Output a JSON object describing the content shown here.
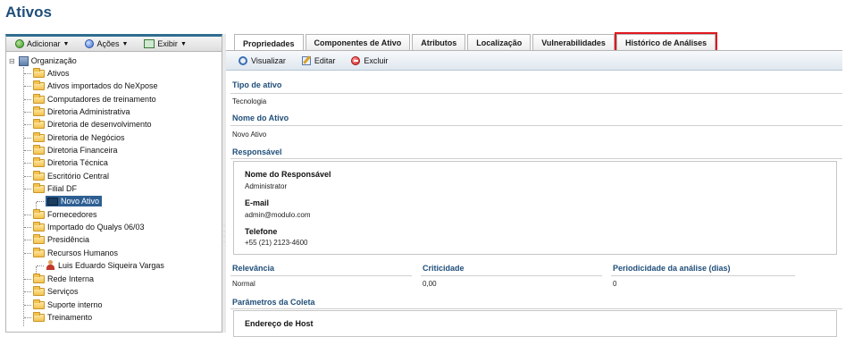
{
  "page": {
    "title": "Ativos"
  },
  "left_toolbar": {
    "add_label": "Adicionar",
    "actions_label": "Ações",
    "view_label": "Exibir"
  },
  "tree": {
    "root": "Organização",
    "items": [
      "Ativos",
      "Ativos importados do NeXpose",
      "Computadores de treinamento",
      "Diretoria Administrativa",
      "Diretoria de desenvolvimento",
      "Diretoria de Negócios",
      "Diretoria Financeira",
      "Diretoria Técnica",
      "Escritório Central",
      "Filial DF",
      "Novo Ativo",
      "Fornecedores",
      "Importado do Qualys 06/03",
      "Presidência",
      "Recursos Humanos",
      "Luis Eduardo Siqueira Vargas",
      "Rede Interna",
      "Serviços",
      "Suporte interno",
      "Treinamento"
    ]
  },
  "tabs": [
    "Propriedades",
    "Componentes de Ativo",
    "Atributos",
    "Localização",
    "Vulnerabilidades",
    "Histórico de Análises"
  ],
  "actions": {
    "view_label": "Visualizar",
    "edit_label": "Editar",
    "delete_label": "Excluir"
  },
  "properties": {
    "asset_type_label": "Tipo de ativo",
    "asset_type_value": "Tecnologia",
    "asset_name_label": "Nome do Ativo",
    "asset_name_value": "Novo Ativo",
    "responsible_label": "Responsável",
    "responsible": {
      "name_label": "Nome do Responsável",
      "name_value": "Administrator",
      "email_label": "E-mail",
      "email_value": "admin@modulo.com",
      "phone_label": "Telefone",
      "phone_value": "+55 (21) 2123-4600"
    },
    "relevance_label": "Relevância",
    "relevance_value": "Normal",
    "criticality_label": "Criticidade",
    "criticality_value": "0,00",
    "periodicity_label": "Periodicidade da análise (dias)",
    "periodicity_value": "0",
    "collection_label": "Parâmetros da Coleta",
    "host_label": "Endereço de Host"
  },
  "colors": {
    "title": "#1f4e79",
    "selection": "#2e5f93",
    "highlight_border": "#e0191f"
  }
}
